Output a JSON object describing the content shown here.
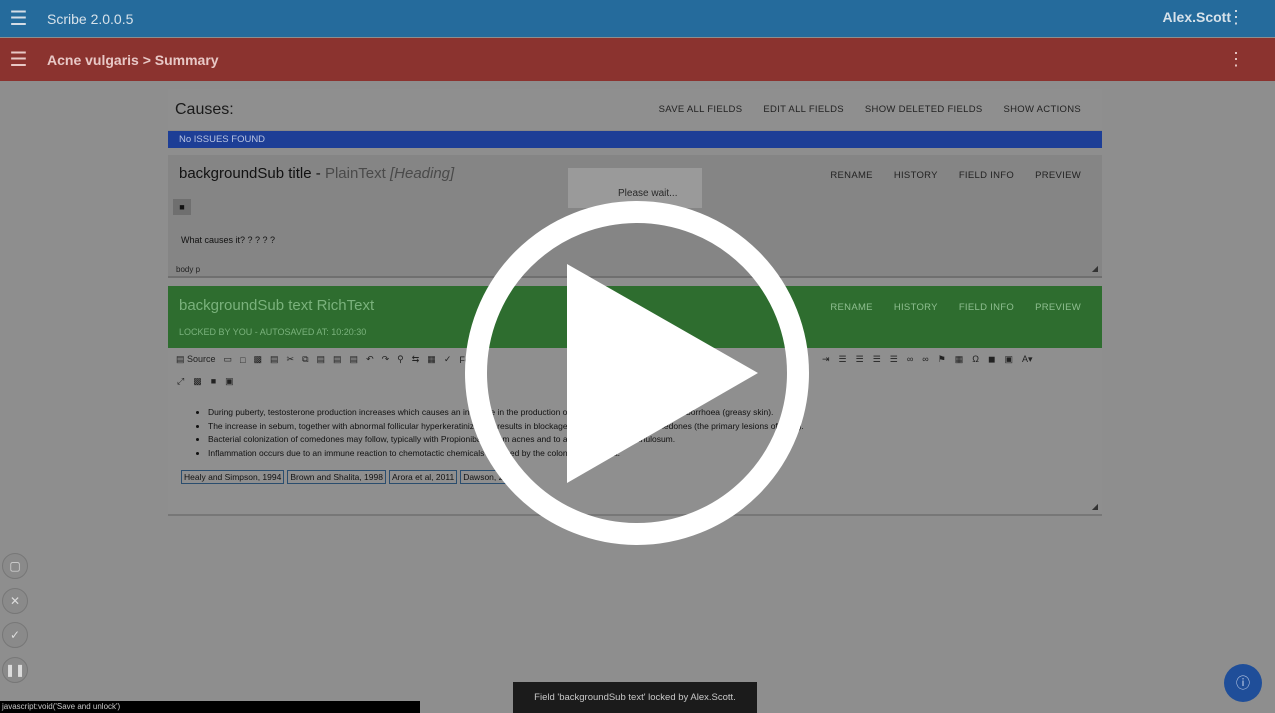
{
  "app": {
    "title": "Scribe 2.0.0.5",
    "user": "Alex.Scott"
  },
  "breadcrumb": "Acne vulgaris > Summary",
  "section": {
    "heading": "Causes:",
    "actions": [
      "SAVE ALL FIELDS",
      "EDIT ALL FIELDS",
      "SHOW DELETED FIELDS",
      "SHOW ACTIONS"
    ],
    "issues": "No ISSUES FOUND"
  },
  "field1": {
    "name": "backgroundSub title -",
    "type": "PlainText",
    "subtype": "[Heading]",
    "actions": [
      "RENAME",
      "HISTORY",
      "FIELD INFO",
      "PREVIEW"
    ],
    "body": "What causes it? ? ? ? ?",
    "path": "body   p"
  },
  "field2": {
    "name": "backgroundSub text RichText",
    "locked": "LOCKED BY YOU - AUTOSAVED AT: 10:20:30",
    "actions": [
      "RENAME",
      "HISTORY",
      "FIELD INFO",
      "PREVIEW"
    ],
    "toolbar": {
      "source": "Source",
      "font": "Font"
    },
    "bullets": [
      "During puberty, testosterone production increases which causes an increase in the production of sebum, the development of seborrhoea (greasy skin).",
      "The increase in sebum, together with abnormal follicular hyperkeratinization, results in blockage and the formation of comedones (the primary lesions of acne).",
      "Bacterial colonization of comedones may follow, typically with Propionibacterium acnes and to a lesser extent P granulosum.",
      "Inflammation occurs due to an immune reaction to chemotactic chemicals released by the colonizing bacteria."
    ],
    "refs": [
      "Healy and Simpson, 1994",
      "Brown and Shalita, 1998",
      "Arora et al, 2011",
      "Dawson, 2..."
    ]
  },
  "wait": "Please wait...",
  "toast": "Field 'backgroundSub text' locked by Alex.Scott.",
  "statusbar": "javascript:void('Save and unlock')",
  "colors": {
    "topbar": "#256b9c",
    "subbar": "#8b332f",
    "locked": "#2e6d2f",
    "issues": "#1d3e96"
  }
}
